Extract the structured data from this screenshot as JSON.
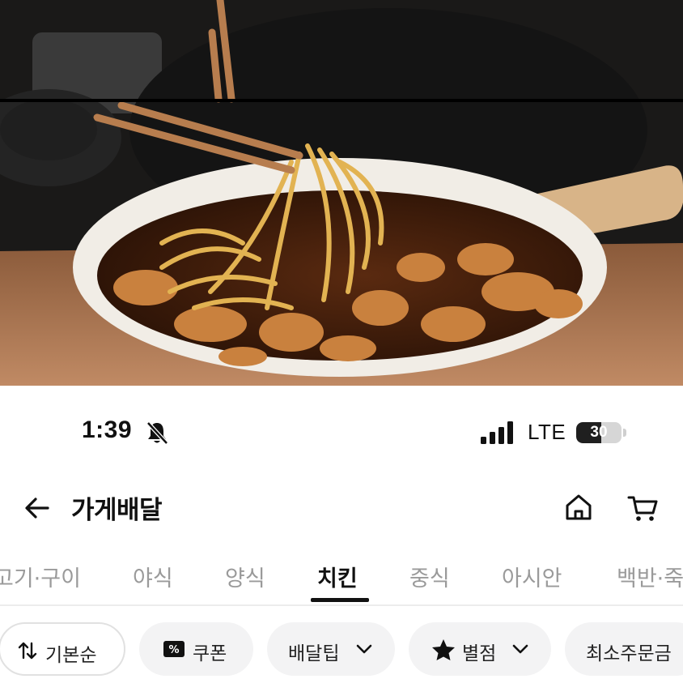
{
  "status_bar": {
    "time": "1:39",
    "network": "LTE",
    "battery_level": "30",
    "battery_percent": 30
  },
  "header": {
    "title": "가게배달",
    "icons": [
      "back-arrow-icon",
      "home-icon",
      "cart-icon"
    ]
  },
  "tabs": {
    "items": [
      "고기·구이",
      "야식",
      "양식",
      "치킨",
      "중식",
      "아시안",
      "백반·죽"
    ],
    "active": "치킨"
  },
  "filters": {
    "sort": "기본순",
    "coupon": "쿠폰",
    "delivery_tip": "배달팁",
    "rating": "별점",
    "min_order": "최소주문금"
  },
  "colors": {
    "active_tab": "#111111",
    "inactive_tab": "#9a9a9a",
    "chip_bg": "#f3f3f4"
  }
}
